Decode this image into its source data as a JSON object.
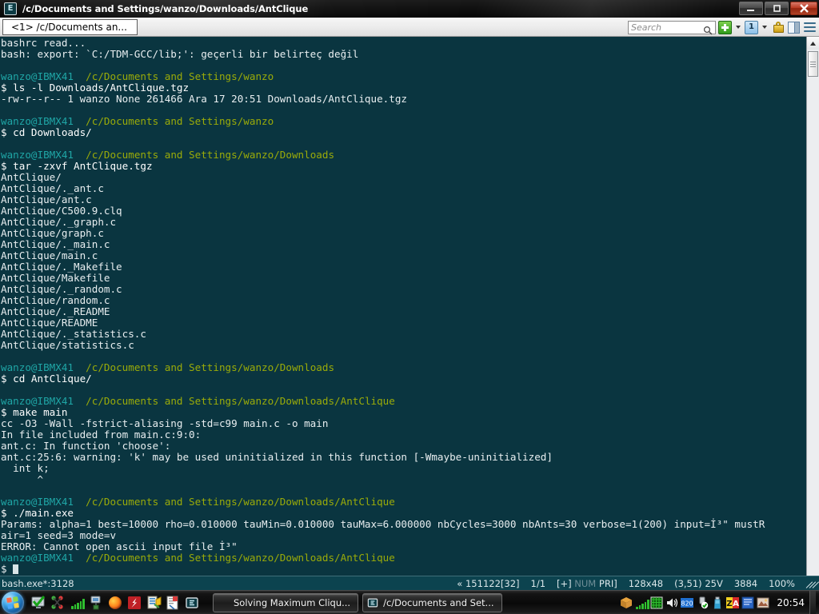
{
  "window": {
    "title": "/c/Documents and Settings/wanzo/Downloads/AntClique",
    "app_icon": "E",
    "buttons": {
      "minimize": "minimize-icon",
      "restore": "restore-icon",
      "close": "close-icon"
    }
  },
  "tabbar": {
    "tabs": [
      {
        "label": "<1> /c/Documents an..."
      }
    ],
    "search": {
      "placeholder": "Search",
      "value": ""
    },
    "buttons": [
      {
        "name": "new-console-button",
        "icon": "plus-icon"
      },
      {
        "name": "new-console-dropdown",
        "icon": "chevron-down-icon"
      },
      {
        "name": "active-console-button",
        "icon": "one-icon",
        "label": "1"
      },
      {
        "name": "active-console-dropdown",
        "icon": "chevron-down-icon"
      },
      {
        "name": "lock-button",
        "icon": "lock-icon"
      },
      {
        "name": "split-pane-button",
        "icon": "split-pane-icon"
      },
      {
        "name": "menu-button",
        "icon": "hamburger-icon"
      }
    ]
  },
  "terminal": {
    "prompt_user": "wanzo@IBMX41",
    "prompt_symbol": "$",
    "colors": {
      "background": "#0a3540",
      "host": "#1fa6a6",
      "path": "#9aab09",
      "text": "#e8eef0"
    },
    "lines": [
      {
        "type": "out",
        "text": "bashrc read..."
      },
      {
        "type": "out",
        "text": "bash: export: `C:/TDM-GCC/lib;': geçerli bir belirteç değil"
      },
      {
        "type": "blank",
        "text": ""
      },
      {
        "type": "prompt",
        "host": "wanzo@IBMX41",
        "path": "/c/Documents and Settings/wanzo"
      },
      {
        "type": "cmd",
        "text": "$ ls -l Downloads/AntClique.tgz"
      },
      {
        "type": "out",
        "text": "-rw-r--r-- 1 wanzo None 261466 Ara 17 20:51 Downloads/AntClique.tgz"
      },
      {
        "type": "blank",
        "text": ""
      },
      {
        "type": "prompt",
        "host": "wanzo@IBMX41",
        "path": "/c/Documents and Settings/wanzo"
      },
      {
        "type": "cmd",
        "text": "$ cd Downloads/"
      },
      {
        "type": "blank",
        "text": ""
      },
      {
        "type": "prompt",
        "host": "wanzo@IBMX41",
        "path": "/c/Documents and Settings/wanzo/Downloads"
      },
      {
        "type": "cmd",
        "text": "$ tar -zxvf AntClique.tgz"
      },
      {
        "type": "out",
        "text": "AntClique/"
      },
      {
        "type": "out",
        "text": "AntClique/._ant.c"
      },
      {
        "type": "out",
        "text": "AntClique/ant.c"
      },
      {
        "type": "out",
        "text": "AntClique/C500.9.clq"
      },
      {
        "type": "out",
        "text": "AntClique/._graph.c"
      },
      {
        "type": "out",
        "text": "AntClique/graph.c"
      },
      {
        "type": "out",
        "text": "AntClique/._main.c"
      },
      {
        "type": "out",
        "text": "AntClique/main.c"
      },
      {
        "type": "out",
        "text": "AntClique/._Makefile"
      },
      {
        "type": "out",
        "text": "AntClique/Makefile"
      },
      {
        "type": "out",
        "text": "AntClique/._random.c"
      },
      {
        "type": "out",
        "text": "AntClique/random.c"
      },
      {
        "type": "out",
        "text": "AntClique/._README"
      },
      {
        "type": "out",
        "text": "AntClique/README"
      },
      {
        "type": "out",
        "text": "AntClique/._statistics.c"
      },
      {
        "type": "out",
        "text": "AntClique/statistics.c"
      },
      {
        "type": "blank",
        "text": ""
      },
      {
        "type": "prompt",
        "host": "wanzo@IBMX41",
        "path": "/c/Documents and Settings/wanzo/Downloads"
      },
      {
        "type": "cmd",
        "text": "$ cd AntClique/"
      },
      {
        "type": "blank",
        "text": ""
      },
      {
        "type": "prompt",
        "host": "wanzo@IBMX41",
        "path": "/c/Documents and Settings/wanzo/Downloads/AntClique"
      },
      {
        "type": "cmd",
        "text": "$ make main"
      },
      {
        "type": "out",
        "text": "cc -O3 -Wall -fstrict-aliasing -std=c99 main.c -o main"
      },
      {
        "type": "out",
        "text": "In file included from main.c:9:0:"
      },
      {
        "type": "out",
        "text": "ant.c: In function 'choose':"
      },
      {
        "type": "out",
        "text": "ant.c:25:6: warning: 'k' may be used uninitialized in this function [-Wmaybe-uninitialized]"
      },
      {
        "type": "out",
        "text": "  int k;"
      },
      {
        "type": "out",
        "text": "      ^"
      },
      {
        "type": "blank",
        "text": ""
      },
      {
        "type": "prompt",
        "host": "wanzo@IBMX41",
        "path": "/c/Documents and Settings/wanzo/Downloads/AntClique"
      },
      {
        "type": "cmd",
        "text": "$ ./main.exe"
      },
      {
        "type": "out",
        "text": "Params: alpha=1 best=10000 rho=0.010000 tauMin=0.010000 tauMax=6.000000 nbCycles=3000 nbAnts=30 verbose=1(200) input=İ³\" mustR"
      },
      {
        "type": "out",
        "text": "air=1 seed=3 mode=v"
      },
      {
        "type": "out",
        "text": "ERROR: Cannot open ascii input file İ³\""
      },
      {
        "type": "prompt",
        "host": "wanzo@IBMX41",
        "path": "/c/Documents and Settings/wanzo/Downloads/AntClique"
      },
      {
        "type": "cursor",
        "text": "$ "
      }
    ]
  },
  "statusbar": {
    "left": "bash.exe*:3128",
    "scroll_marker": "« 151122[32]",
    "pane": "1/1",
    "plus": "[+]",
    "num": "NUM",
    "pri": "PRI]",
    "size": "128x48",
    "cursor_pos": "(3,51) 25V",
    "mem": "3884",
    "zoom": "100%"
  },
  "taskbar": {
    "start": "start-orb",
    "quicklaunch": [
      {
        "name": "monitor-check-icon"
      },
      {
        "name": "git-icon"
      },
      {
        "name": "signal-bars-icon"
      },
      {
        "name": "network-icon"
      },
      {
        "name": "firefox-icon"
      },
      {
        "name": "filezilla-icon"
      },
      {
        "name": "printer-icon"
      },
      {
        "name": "document-icon"
      },
      {
        "name": "conemu-icon"
      }
    ],
    "tasks": [
      {
        "label": "Solving Maximum Cliqu...",
        "icon": "firefox-icon"
      },
      {
        "label": "/c/Documents and Set...",
        "icon": "conemu-icon"
      }
    ],
    "tray": [
      {
        "name": "package-icon"
      },
      {
        "name": "signal-bars-icon"
      },
      {
        "name": "grid-icon"
      },
      {
        "name": "volume-icon"
      },
      {
        "name": "counter-icon",
        "label": "820"
      },
      {
        "name": "usb-safe-remove-icon"
      },
      {
        "name": "bottle-icon"
      },
      {
        "name": "zonealarm-icon",
        "label": "ZA"
      },
      {
        "name": "blue-app-icon"
      },
      {
        "name": "photo-icon"
      }
    ],
    "clock": "20:54"
  }
}
